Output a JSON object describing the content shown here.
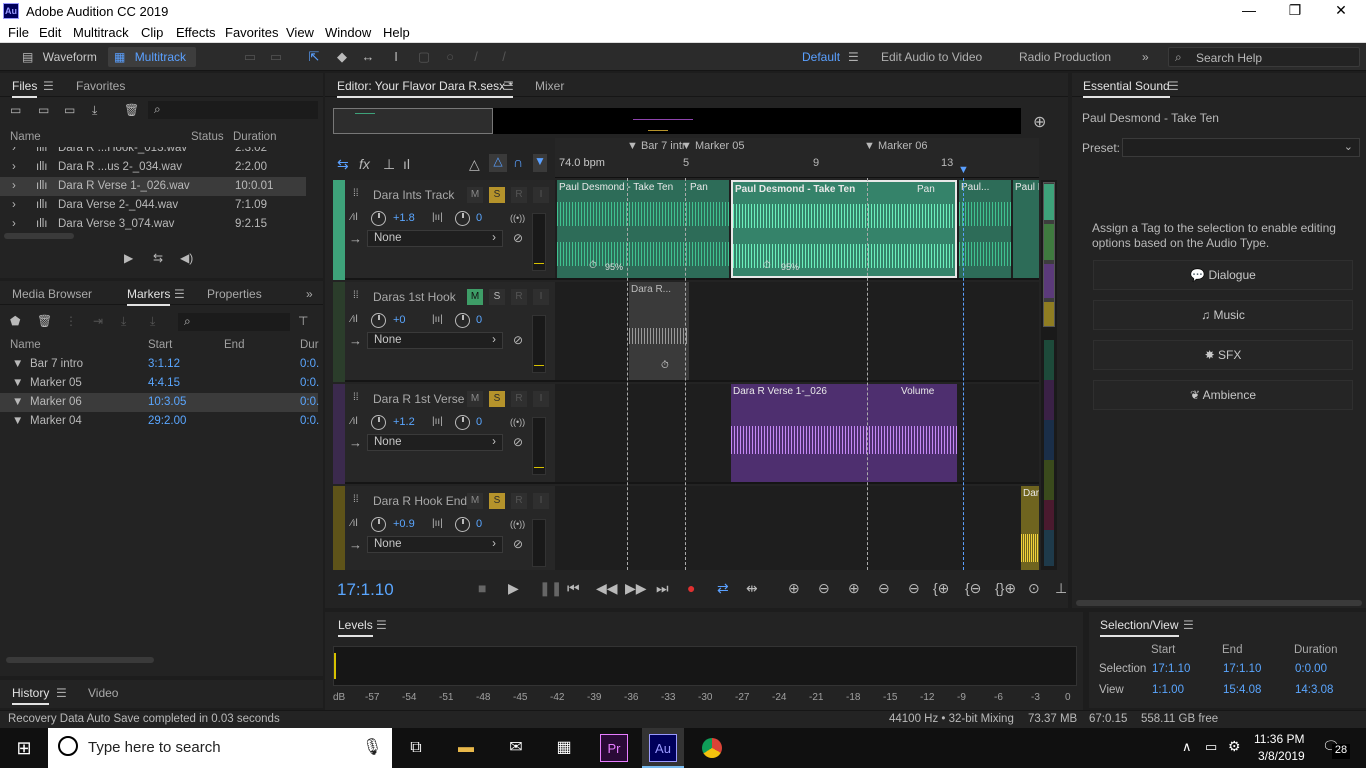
{
  "window": {
    "title": "Adobe Audition CC 2019",
    "logo": "Au",
    "min": "—",
    "max": "❐",
    "close": "✕"
  },
  "menu": [
    "File",
    "Edit",
    "Multitrack",
    "Clip",
    "Effects",
    "Favorites",
    "View",
    "Window",
    "Help"
  ],
  "toolbar": {
    "waveform_label": "Waveform",
    "multitrack_label": "Multitrack",
    "workspaces": {
      "default": "Default",
      "edit_video": "Edit Audio to Video",
      "radio": "Radio Production"
    },
    "search_placeholder": "Search Help"
  },
  "files_panel": {
    "tabs": {
      "files": "Files",
      "favorites": "Favorites"
    },
    "columns": {
      "name": "Name",
      "status": "Status",
      "duration": "Duration"
    },
    "rows": [
      {
        "name": "Dara R ...Hook-_013.wav",
        "duration": "2:3.02"
      },
      {
        "name": "Dara R ...us 2-_034.wav",
        "duration": "2:2.00"
      },
      {
        "name": "Dara R Verse 1-_026.wav",
        "duration": "10:0.01"
      },
      {
        "name": "Dara Verse 2-_044.wav",
        "duration": "7:1.09"
      },
      {
        "name": "Dara Verse 3_074.wav",
        "duration": "9:2.15"
      }
    ]
  },
  "markers_panel": {
    "tabs": {
      "media": "Media Browser",
      "markers": "Markers",
      "properties": "Properties"
    },
    "columns": {
      "name": "Name",
      "start": "Start",
      "end": "End",
      "dur": "Dur"
    },
    "rows": [
      {
        "name": "Bar 7 intro",
        "start": "3:1.12",
        "dur": "0:0."
      },
      {
        "name": "Marker 05",
        "start": "4:4.15",
        "dur": "0:0."
      },
      {
        "name": "Marker 06",
        "start": "10:3.05",
        "dur": "0:0."
      },
      {
        "name": "Marker 04",
        "start": "29:2.00",
        "dur": "0:0."
      }
    ]
  },
  "history_panel": {
    "history": "History",
    "video": "Video"
  },
  "editor": {
    "tab": "Editor: Your Flavor Dara R.sesx *",
    "mixer": "Mixer",
    "tempo": "74.0 bpm",
    "ruler": [
      "5",
      "9",
      "13"
    ],
    "markers": [
      "Bar 7 intr",
      "Marker 05",
      "Marker 06"
    ],
    "time": "17:1.10",
    "tracks": [
      {
        "name": "Dara Ints Track",
        "vol": "+1.8",
        "pan": "0",
        "input": "None",
        "color": "#3ea27a"
      },
      {
        "name": "Daras 1st Hook",
        "vol": "+0",
        "pan": "0",
        "input": "None",
        "color": "#3f7a3f"
      },
      {
        "name": "Dara R 1st Verse",
        "vol": "+1.2",
        "pan": "0",
        "input": "None",
        "color": "#5b3a7a"
      },
      {
        "name": "Dara R Hook End",
        "vol": "+0.9",
        "pan": "0",
        "input": "None",
        "color": "#8f7d22"
      }
    ],
    "clips": {
      "c1": "Paul Desmond - Take Ten",
      "c1b": "Pan",
      "c2": "Paul Desmond - Take Ten",
      "c2b": "Pan",
      "c3": "Paul...",
      "c4": "Paul D",
      "c5": "Dara R...",
      "c6": "Dara R Verse 1-_026",
      "c6b": "Volume",
      "c7": "Dar",
      "pct1": "95%",
      "pct2": "95%"
    },
    "msr": {
      "m": "M",
      "s": "S",
      "r": "R",
      "i": "I"
    }
  },
  "levels": {
    "title": "Levels",
    "scale": [
      "dB",
      "-57",
      "-54",
      "-51",
      "-48",
      "-45",
      "-42",
      "-39",
      "-36",
      "-33",
      "-30",
      "-27",
      "-24",
      "-21",
      "-18",
      "-15",
      "-12",
      "-9",
      "-6",
      "-3",
      "0"
    ]
  },
  "essential_sound": {
    "title": "Essential Sound",
    "clip": "Paul Desmond - Take Ten",
    "preset_label": "Preset:",
    "hint": "Assign a Tag to the selection to enable editing options based on the Audio Type.",
    "buttons": [
      "Dialogue",
      "Music",
      "SFX",
      "Ambience"
    ]
  },
  "selection_view": {
    "title": "Selection/View",
    "cols": [
      "Start",
      "End",
      "Duration"
    ],
    "selection": {
      "label": "Selection",
      "start": "17:1.10",
      "end": "17:1.10",
      "dur": "0:0.00"
    },
    "view": {
      "label": "View",
      "start": "1:1.00",
      "end": "15:4.08",
      "dur": "14:3.08"
    }
  },
  "status": {
    "left": "Recovery Data Auto Save completed in 0.03 seconds",
    "rate": "44100 Hz • 32-bit Mixing",
    "mem": "73.37 MB",
    "dur": "67:0.15",
    "free": "558.11 GB free"
  },
  "taskbar": {
    "search": "Type here to search",
    "time": "11:36 PM",
    "date": "3/8/2019",
    "notif": "28",
    "pr": "Pr",
    "au": "Au"
  }
}
